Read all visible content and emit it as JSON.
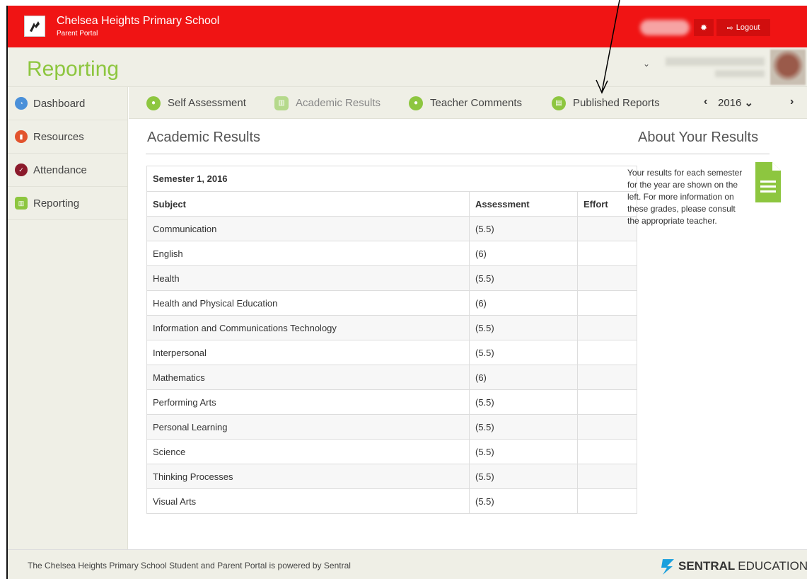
{
  "school": {
    "name": "Chelsea Heights Primary School",
    "subtitle": "Parent Portal"
  },
  "topbar": {
    "logout_label": "Logout",
    "gear_icon": "gear-icon",
    "logout_icon": "sign-out-icon"
  },
  "header": {
    "page_title": "Reporting"
  },
  "sidebar": {
    "items": [
      {
        "label": "Dashboard",
        "icon": "dashboard-icon",
        "color": "#4a90d9"
      },
      {
        "label": "Resources",
        "icon": "book-icon",
        "color": "#e2532d"
      },
      {
        "label": "Attendance",
        "icon": "check-circle-icon",
        "color": "#8b1a2b"
      },
      {
        "label": "Reporting",
        "icon": "bar-chart-icon",
        "color": "#8dc63f"
      }
    ]
  },
  "tabs": {
    "items": [
      {
        "label": "Self Assessment",
        "icon": "user-icon"
      },
      {
        "label": "Academic Results",
        "icon": "bar-chart-icon"
      },
      {
        "label": "Teacher Comments",
        "icon": "comment-icon"
      },
      {
        "label": "Published Reports",
        "icon": "document-icon"
      }
    ],
    "active": "Academic Results",
    "year": "2016"
  },
  "main": {
    "section_title": "Academic Results",
    "semester": "Semester 1, 2016",
    "columns": [
      "Subject",
      "Assessment",
      "Effort"
    ],
    "rows": [
      {
        "subject": "Communication",
        "assessment": "(5.5)",
        "effort": ""
      },
      {
        "subject": "English",
        "assessment": "(6)",
        "effort": ""
      },
      {
        "subject": "Health",
        "assessment": "(5.5)",
        "effort": ""
      },
      {
        "subject": "Health and Physical Education",
        "assessment": "(6)",
        "effort": ""
      },
      {
        "subject": "Information and Communications Technology",
        "assessment": "(5.5)",
        "effort": ""
      },
      {
        "subject": "Interpersonal",
        "assessment": "(5.5)",
        "effort": ""
      },
      {
        "subject": "Mathematics",
        "assessment": "(6)",
        "effort": ""
      },
      {
        "subject": "Performing Arts",
        "assessment": "(5.5)",
        "effort": ""
      },
      {
        "subject": "Personal Learning",
        "assessment": "(5.5)",
        "effort": ""
      },
      {
        "subject": "Science",
        "assessment": "(5.5)",
        "effort": ""
      },
      {
        "subject": "Thinking Processes",
        "assessment": "(5.5)",
        "effort": ""
      },
      {
        "subject": "Visual Arts",
        "assessment": "(5.5)",
        "effort": ""
      }
    ]
  },
  "about": {
    "title": "About Your Results",
    "text": "Your results for each semester for the year are shown on the left. For more information on these grades, please consult the appropriate teacher."
  },
  "footer": {
    "text": "The Chelsea Heights Primary School Student and Parent Portal is powered by Sentral",
    "brand_bold": "SENTRAL",
    "brand_light": "EDUCATION"
  },
  "colors": {
    "topbar": "#f01414",
    "accent_green": "#8dc63f",
    "panel": "#efefe6"
  }
}
